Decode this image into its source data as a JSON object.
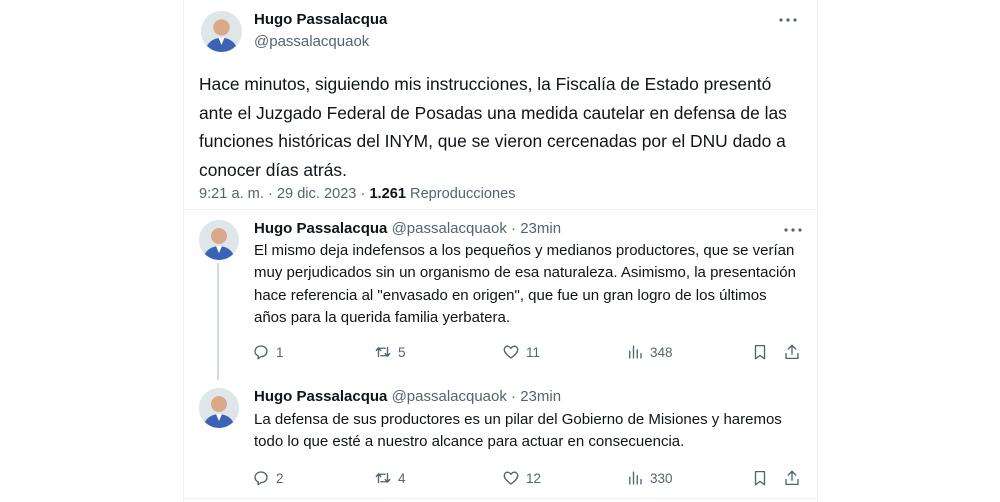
{
  "main": {
    "author_name": "Hugo Passalacqua",
    "author_handle": "@passalacquaok",
    "text": "Hace minutos, siguiendo mis instrucciones, la Fiscalía de Estado presentó ante el Juzgado Federal de Posadas una medida cautelar en defensa de las funciones históricas del INYM, que se vieron cercenadas por el DNU dado a conocer días atrás.",
    "time": "9:21 a. m.",
    "sep": "·",
    "date": "29 dic. 2023",
    "views_count": "1.261",
    "views_label": "Reproducciones",
    "more_icon": "more-horizontal-icon"
  },
  "replies": [
    {
      "author_name": "Hugo Passalacqua",
      "author_handle": "@passalacquaok",
      "sep": "·",
      "age": "23min",
      "text": "El mismo deja indefensos a los pequeños y medianos productores, que se verían muy perjudicados sin un organismo de esa naturaleza. Asimismo, la presentación hace referencia al \"envasado en origen\", que fue un gran logro de los últimos años para la querida familia yerbatera.",
      "replies_count": "1",
      "reposts_count": "5",
      "likes_count": "11",
      "views_count": "348"
    },
    {
      "author_name": "Hugo Passalacqua",
      "author_handle": "@passalacquaok",
      "sep": "·",
      "age": "23min",
      "text": "La defensa de sus productores es un pilar del Gobierno de Misiones y haremos todo lo que esté a nuestro alcance para actuar en consecuencia.",
      "replies_count": "2",
      "reposts_count": "4",
      "likes_count": "12",
      "views_count": "330"
    }
  ],
  "icons": {
    "reply": "reply-icon",
    "repost": "repost-icon",
    "like": "heart-icon",
    "views": "views-chart-icon",
    "bookmark": "bookmark-icon",
    "share": "share-icon"
  },
  "colors": {
    "text": "#0f1419",
    "secondary": "#536471",
    "border": "#eff3f4",
    "thread_line": "#cfd9de"
  }
}
